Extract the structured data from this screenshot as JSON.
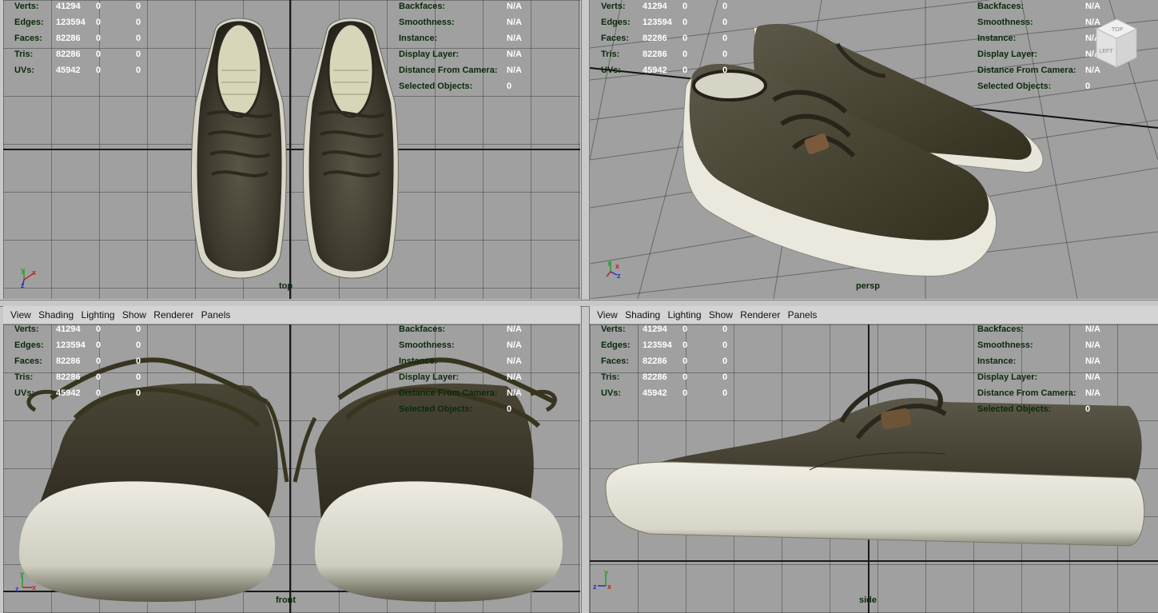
{
  "menus": [
    "View",
    "Shading",
    "Lighting",
    "Show",
    "Renderer",
    "Panels"
  ],
  "stats_left": [
    {
      "label": "Verts:",
      "v1": "41294",
      "v2": "0",
      "v3": "0"
    },
    {
      "label": "Edges:",
      "v1": "123594",
      "v2": "0",
      "v3": "0"
    },
    {
      "label": "Faces:",
      "v1": "82286",
      "v2": "0",
      "v3": "0"
    },
    {
      "label": "Tris:",
      "v1": "82286",
      "v2": "0",
      "v3": "0"
    },
    {
      "label": "UVs:",
      "v1": "45942",
      "v2": "0",
      "v3": "0"
    }
  ],
  "stats_right": [
    {
      "label": "Backfaces:",
      "value": "N/A"
    },
    {
      "label": "Smoothness:",
      "value": "N/A"
    },
    {
      "label": "Instance:",
      "value": "N/A"
    },
    {
      "label": "Display Layer:",
      "value": "N/A"
    },
    {
      "label": "Distance From Camera:",
      "value": "N/A"
    },
    {
      "label": "Selected Objects:",
      "value": "0"
    }
  ],
  "viewports": {
    "top": {
      "camera": "top"
    },
    "persp": {
      "camera": "persp"
    },
    "front": {
      "camera": "front"
    },
    "side": {
      "camera": "side"
    }
  },
  "axes": {
    "x": "x",
    "y": "y",
    "z": "z"
  },
  "viewcube": {
    "top": "TOP",
    "left": "LEFT"
  },
  "colors": {
    "viewport_bg": "#a0a0a0",
    "hud_label": "#0a2a0a",
    "hud_value": "#ffffff",
    "shoe_upper": "#3e3a2e",
    "shoe_sole": "#e8e6dc",
    "insole": "#d8d6b8"
  }
}
